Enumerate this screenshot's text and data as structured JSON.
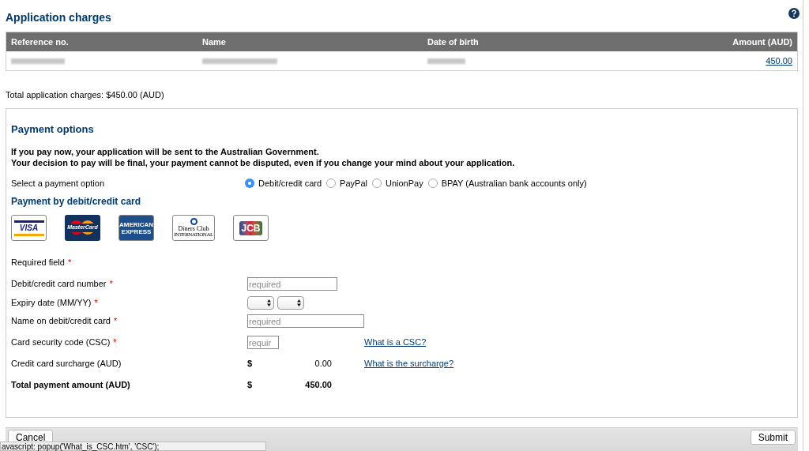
{
  "title": "Application charges",
  "table": {
    "columns": [
      "Reference no.",
      "Name",
      "Date of birth",
      "Amount (AUD)"
    ],
    "rows": [
      {
        "amount": "450.00"
      }
    ]
  },
  "total_charges": "Total application charges: $450.00 (AUD)",
  "payment": {
    "title": "Payment options",
    "notice": [
      "If you pay now, your application will be sent to the Australian Government.",
      "Your decision to pay will be final, your payment cannot be disputed, even if you change your mind about your application."
    ],
    "option_label": "Select a payment option",
    "options": [
      {
        "label": "Debit/credit card",
        "selected": true
      },
      {
        "label": "PayPal",
        "selected": false
      },
      {
        "label": "UnionPay",
        "selected": false
      },
      {
        "label": "BPAY (Australian bank accounts only)",
        "selected": false
      }
    ],
    "card_title": "Payment by debit/credit card",
    "cards": [
      {
        "kind": "visa",
        "label": "VISA"
      },
      {
        "kind": "mastercard",
        "label": "MasterCard"
      },
      {
        "kind": "amex",
        "label": "AMERICAN EXPRESS"
      },
      {
        "kind": "diners",
        "label": "Diners Club",
        "sublabel": "INTERNATIONAL"
      },
      {
        "kind": "jcb",
        "label": "JCB"
      }
    ],
    "required_note": {
      "label": "Required field",
      "marker": "*"
    },
    "fields": [
      {
        "kind": "text",
        "label": "Debit/credit card number",
        "marker": "*",
        "placeholder": "required"
      },
      {
        "kind": "expiry",
        "label": "Expiry date (MM/YY)",
        "marker": "*"
      },
      {
        "kind": "wide_text",
        "label": "Name on debit/credit card",
        "marker": "*",
        "placeholder": "required"
      },
      {
        "kind": "short_text",
        "label": "Card security code (CSC)",
        "marker": "*",
        "placeholder": "requir",
        "link": "What is a CSC?"
      },
      {
        "kind": "amount",
        "label": "Credit card surcharge (AUD)",
        "currency": "$",
        "value": "0.00",
        "link": "What is the surcharge?"
      },
      {
        "kind": "total",
        "label": "Total payment amount (AUD)",
        "currency": "$",
        "value": "450.00"
      }
    ]
  },
  "footer": {
    "buttons": [
      {
        "label": "Cancel"
      },
      {
        "label": "Submit"
      }
    ]
  },
  "status_bar": "avascript: popup('What_is_CSC.htm', 'CSC');"
}
